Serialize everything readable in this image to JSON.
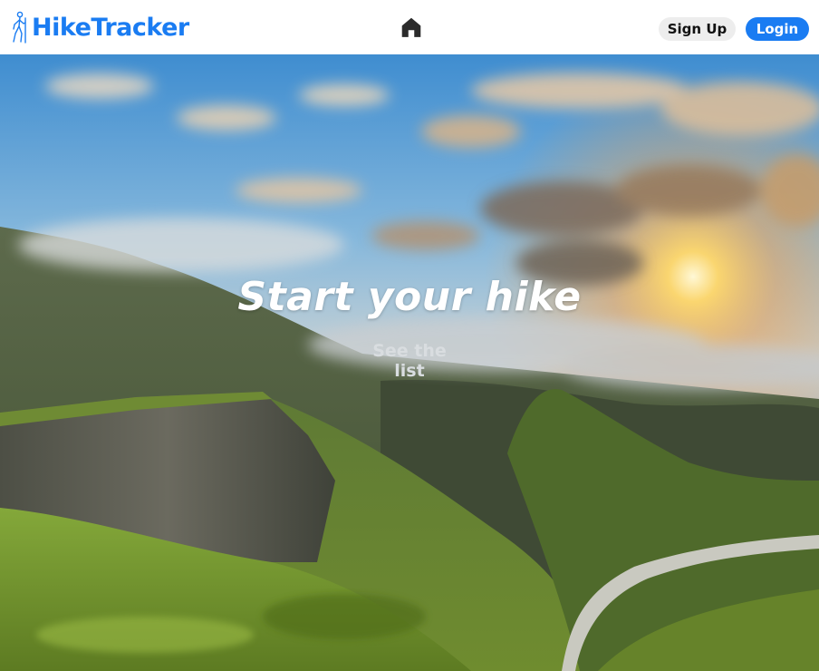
{
  "navbar": {
    "brand": "HikeTracker",
    "brand_color": "#1a7cf2",
    "home_icon": "home-icon",
    "signup_label": "Sign Up",
    "login_label": "Login"
  },
  "hero": {
    "title": "Start your hike",
    "cta_label": "See the list",
    "background": "mountain-valley-sunrise-photo"
  }
}
